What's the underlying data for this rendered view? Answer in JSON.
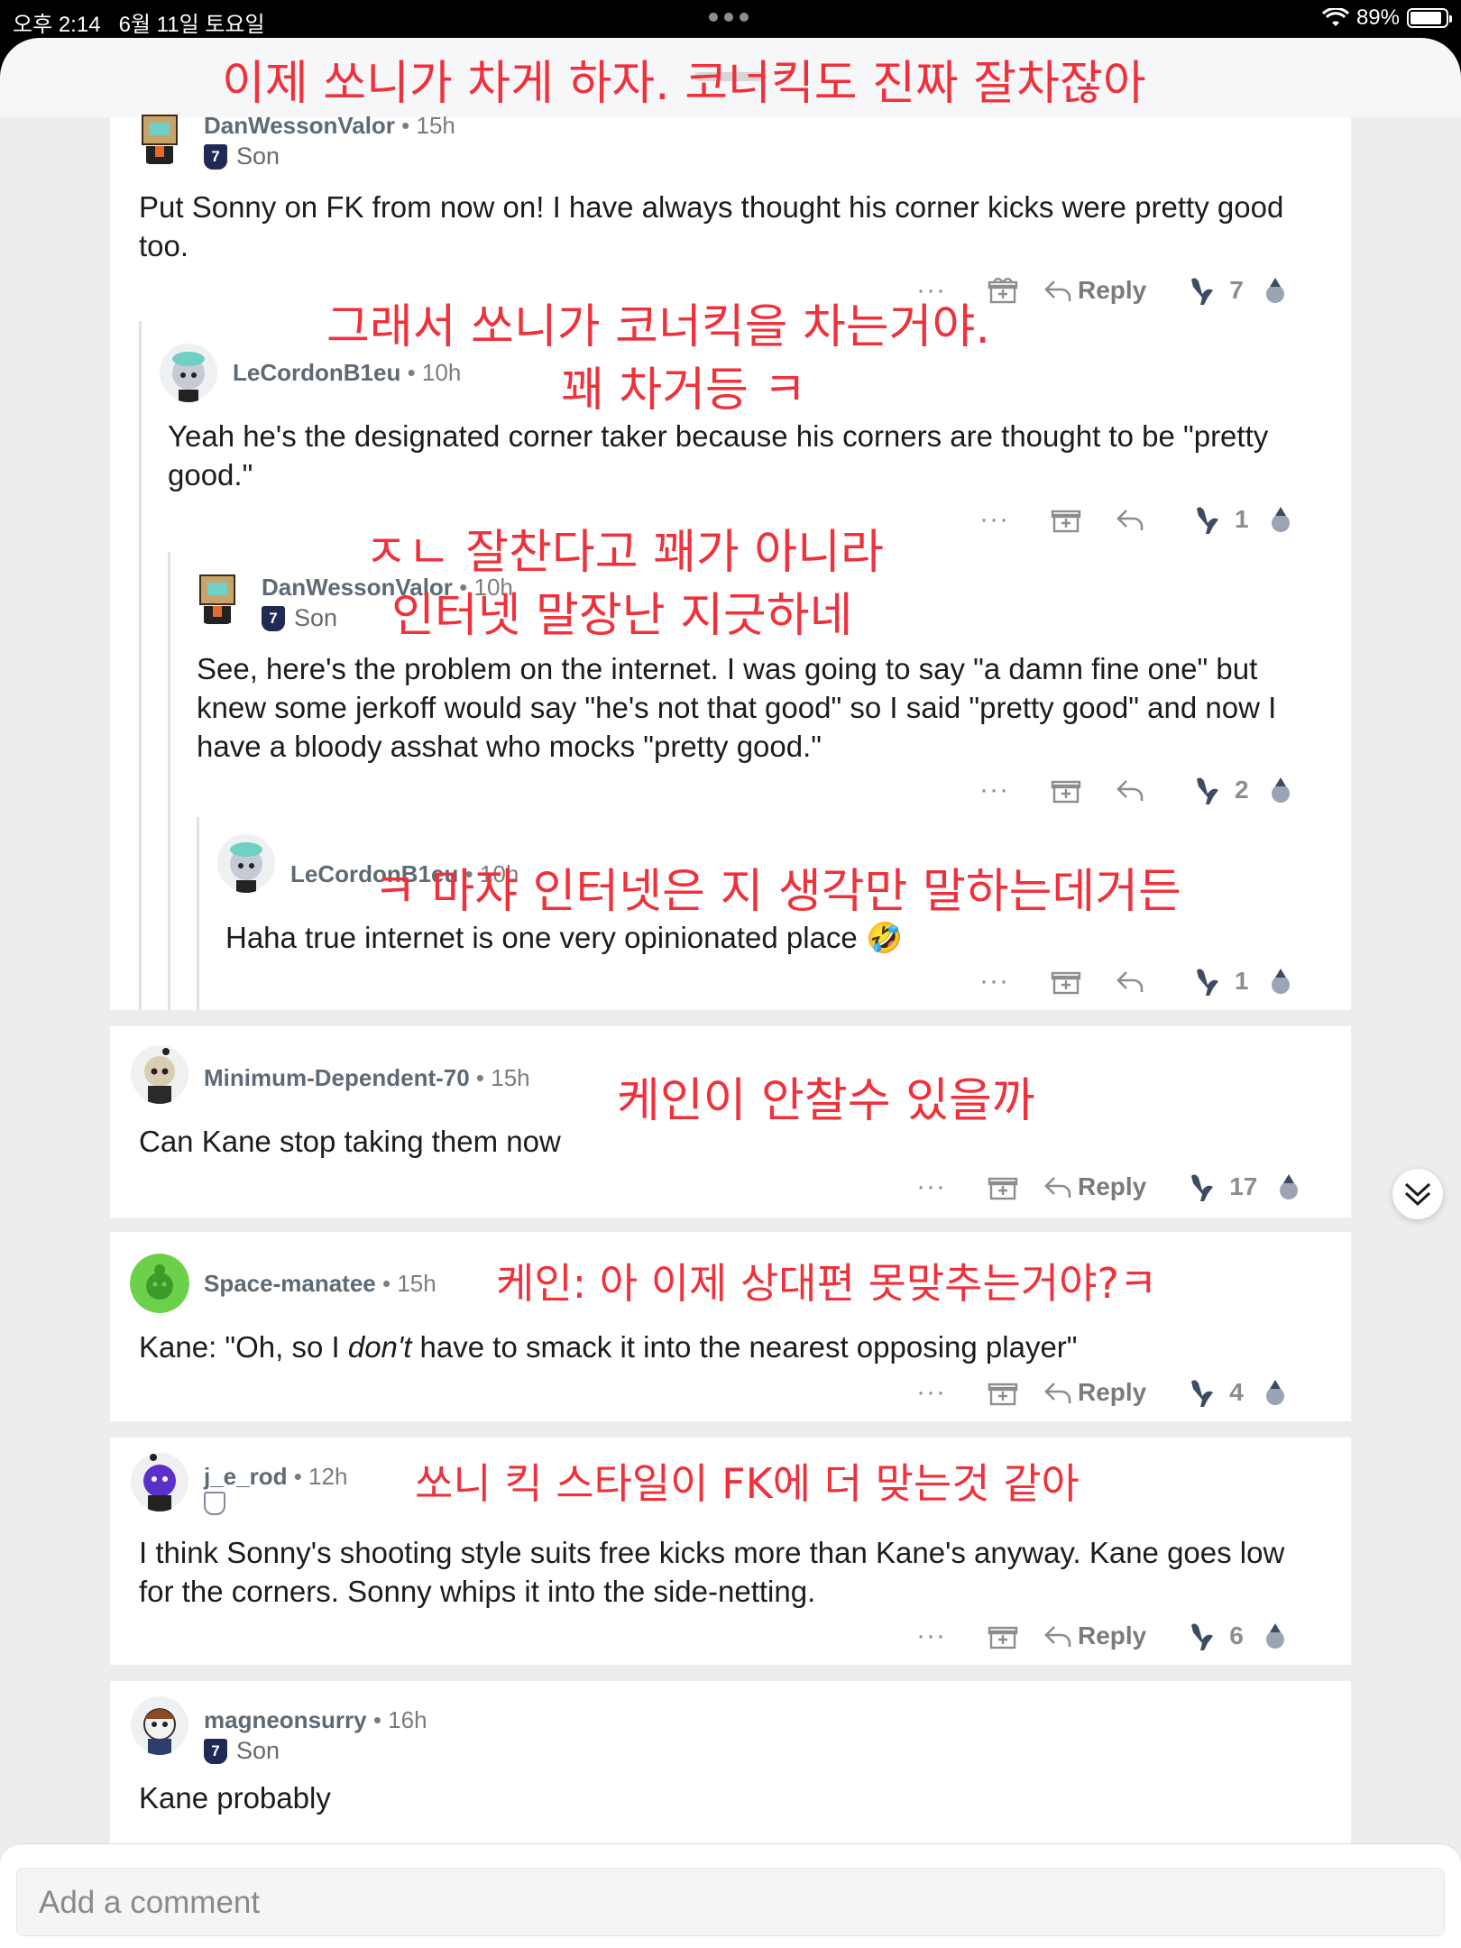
{
  "status": {
    "time": "오후 2:14",
    "date": "6월 11일 토요일",
    "battery": "89%",
    "battery_level": 0.89
  },
  "annotations": {
    "a1": "이제 쏘니가 차게 하자. 코너킥도 진짜 잘차잖아",
    "a2_l1": "그래서 쏘니가 코너킥을 차는거야.",
    "a2_l2": "꽤 차거등 ㅋ",
    "a3_l1": "ㅈㄴ 잘찬다고 꽤가 아니라",
    "a3_l2": "인터넷 말장난 지긋하네",
    "a4": "ㅋ 마쟈 인터넷은 지 생각만 말하는데거든",
    "a5": "케인이 안찰수 있을까",
    "a6": "케인: 아 이제 상대편 못맞추는거야?ㅋ",
    "a7": "쏘니 킥 스타일이 FK에 더 맞는것 같아"
  },
  "comments": [
    {
      "user": "DanWessonValor",
      "time": "• 15h",
      "flair": "Son",
      "body": "Put Sonny on FK from now on! I have always thought his corner kicks were pretty good too.",
      "reply": "Reply",
      "votes": "7"
    },
    {
      "user": "LeCordonB1eu",
      "time": "• 10h",
      "body": "Yeah he's the designated corner taker because his corners are thought to be \"pretty good.\"",
      "votes": "1"
    },
    {
      "user": "DanWessonValor",
      "time": "• 10h",
      "flair": "Son",
      "body": "See, here's the problem on the internet. I was going to say \"a damn fine one\" but knew some jerkoff would say \"he's not that good\" so I said \"pretty good\" and now I have a bloody asshat who mocks \"pretty good.\"",
      "votes": "2"
    },
    {
      "user": "LeCordonB1eu",
      "time": "• 10h",
      "body": "Haha true internet is one very opinionated place 🤣",
      "votes": "1"
    },
    {
      "user": "Minimum-Dependent-70",
      "time": "• 15h",
      "body": "Can Kane stop taking them now",
      "reply": "Reply",
      "votes": "17"
    },
    {
      "user": "Space-manatee",
      "time": "• 15h",
      "body_pre": "Kane: \"Oh, so I ",
      "body_em": "don't",
      "body_post": " have to smack it into the nearest opposing player\"",
      "reply": "Reply",
      "votes": "4"
    },
    {
      "user": "j_e_rod",
      "time": "• 12h",
      "body": "I think Sonny's shooting style suits free kicks more than Kane's anyway. Kane goes low for the corners. Sonny whips it into the side-netting.",
      "reply": "Reply",
      "votes": "6"
    },
    {
      "user": "magneonsurry",
      "time": "• 16h",
      "flair": "Son",
      "body": "Kane probably"
    }
  ],
  "composer": {
    "placeholder": "Add a comment"
  },
  "icons": {
    "more": "more-icon",
    "award": "award-icon",
    "reply": "reply-arrow-icon",
    "upvote": "rooster-upvote-icon",
    "downvote": "downvote-icon",
    "jump": "double-chevron-down-icon"
  }
}
